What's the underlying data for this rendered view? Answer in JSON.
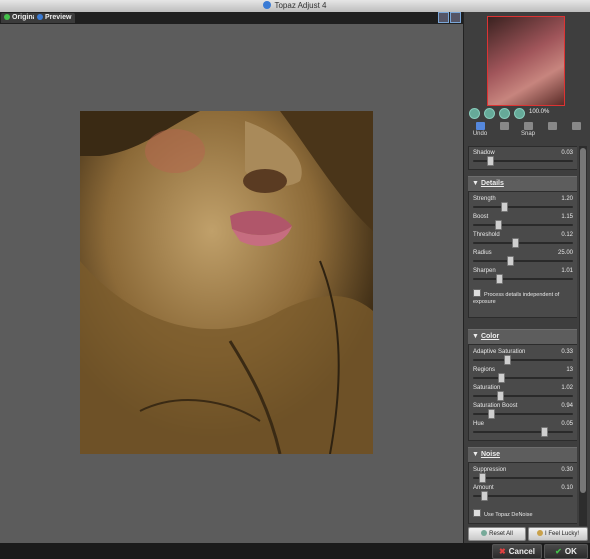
{
  "window": {
    "title": "Topaz Adjust 4"
  },
  "tabs": [
    {
      "label": "Original",
      "dot": "#43c04a"
    },
    {
      "label": "Preview",
      "dot": "#3a7bd5"
    }
  ],
  "navigator": {
    "zoom": "100.0%"
  },
  "tools": [
    {
      "label": "Undo",
      "icon": "undo-icon"
    },
    {
      "label": "",
      "icon": "redo-icon"
    },
    {
      "label": "Snap",
      "icon": "snap-icon"
    },
    {
      "label": "",
      "icon": "comment-icon"
    }
  ],
  "sections": {
    "exposure_tail": {
      "shadow": {
        "label": "Shadow",
        "value": "0.03",
        "pos": 0.16
      }
    },
    "details": {
      "title": "Details",
      "sliders": [
        {
          "label": "Strength",
          "value": "1.20",
          "pos": 0.3
        },
        {
          "label": "Boost",
          "value": "1.15",
          "pos": 0.24
        },
        {
          "label": "Threshold",
          "value": "0.12",
          "pos": 0.41
        },
        {
          "label": "Radius",
          "value": "25.00",
          "pos": 0.36
        },
        {
          "label": "Sharpen",
          "value": "1.01",
          "pos": 0.25
        }
      ],
      "checkbox": "Process details independent of exposure"
    },
    "color": {
      "title": "Color",
      "sliders": [
        {
          "label": "Adaptive Saturation",
          "value": "0.33",
          "pos": 0.33
        },
        {
          "label": "Regions",
          "value": "13",
          "pos": 0.27
        },
        {
          "label": "Saturation",
          "value": "1.02",
          "pos": 0.26
        },
        {
          "label": "Saturation Boost",
          "value": "0.94",
          "pos": 0.17
        },
        {
          "label": "Hue",
          "value": "0.05",
          "pos": 0.7
        }
      ]
    },
    "noise": {
      "title": "Noise",
      "sliders": [
        {
          "label": "Suppression",
          "value": "0.30",
          "pos": 0.08
        },
        {
          "label": "Amount",
          "value": "0.10",
          "pos": 0.1
        }
      ],
      "checkbox": "Use Topaz DeNoise"
    }
  },
  "panel_buttons": {
    "reset": "Reset All",
    "lucky": "I Feel Lucky!"
  },
  "footer": {
    "cancel": "Cancel",
    "ok": "OK"
  }
}
